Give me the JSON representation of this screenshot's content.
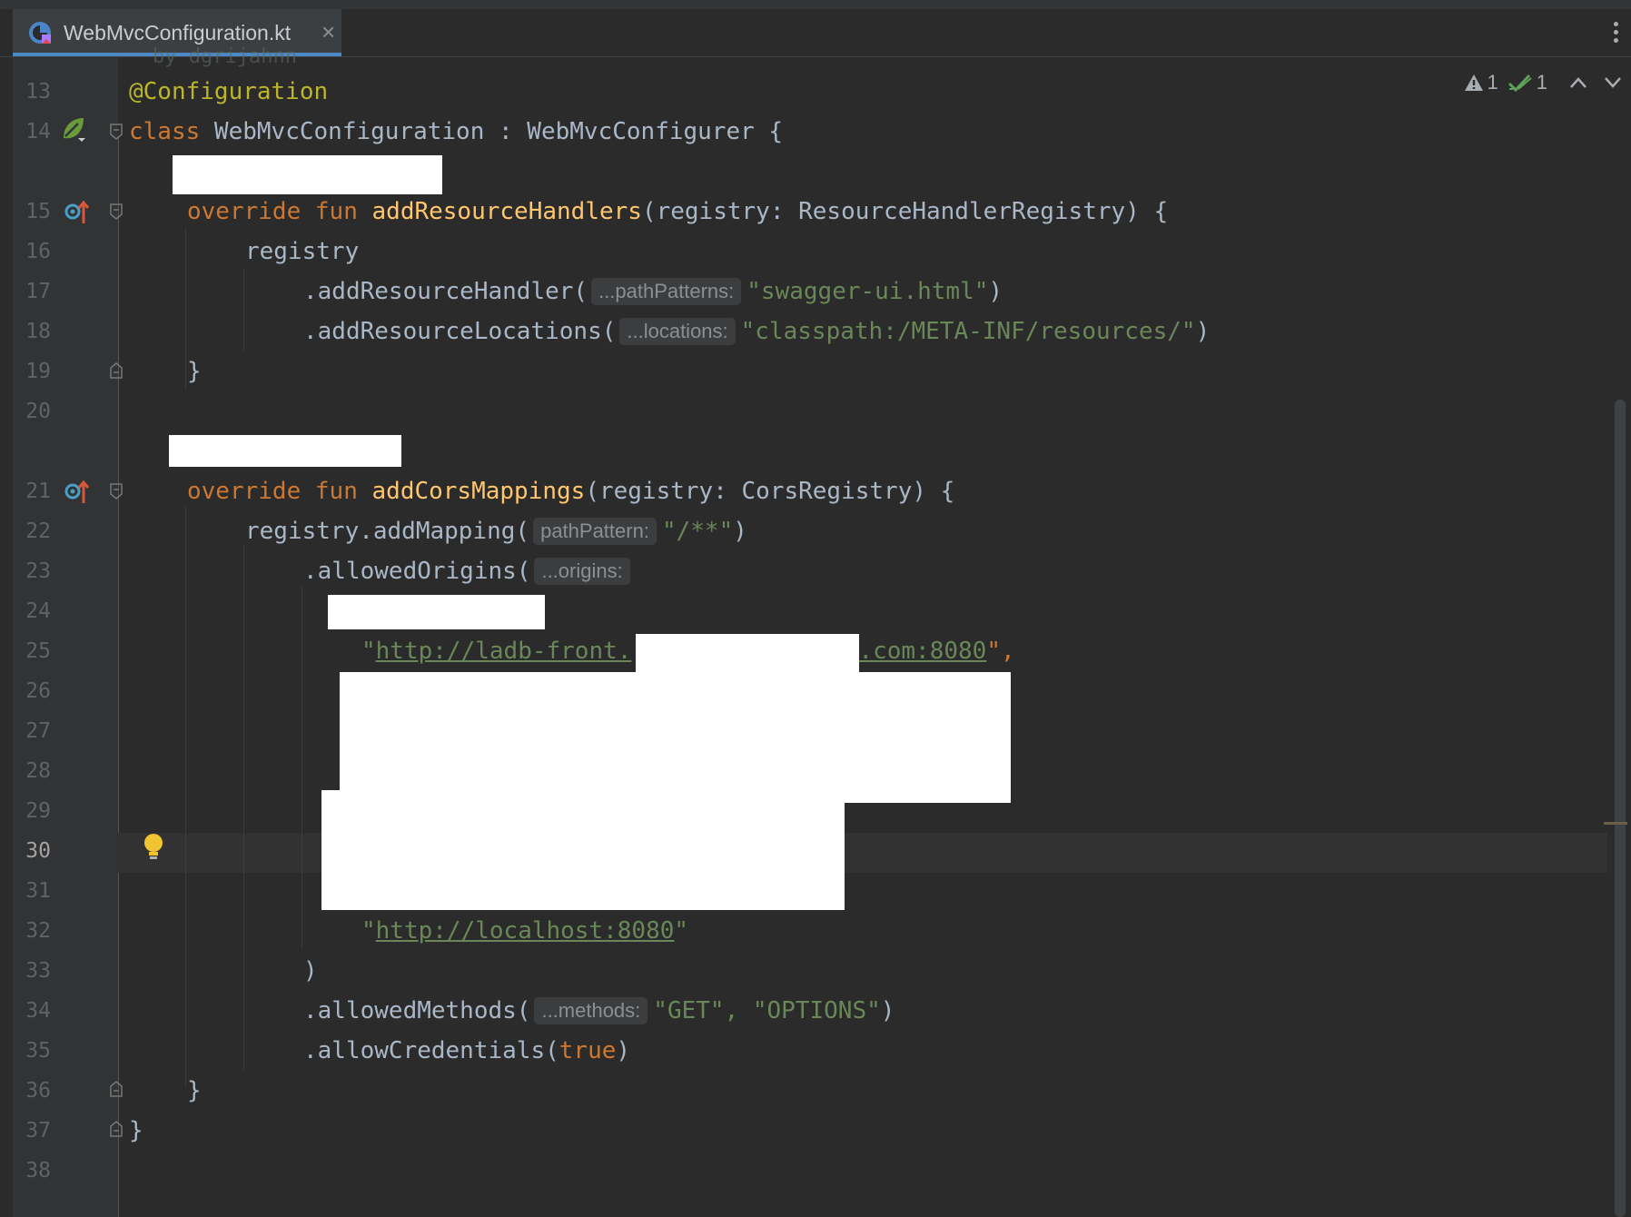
{
  "tab": {
    "filename": "WebMvcConfiguration.kt"
  },
  "indicators": {
    "warnings": "1",
    "checks": "1"
  },
  "partial_line_text": "by dgrijahnn",
  "editor": {
    "line_numbers": [
      "13",
      "14",
      "15",
      "16",
      "17",
      "18",
      "19",
      "20",
      "21",
      "22",
      "23",
      "24",
      "25",
      "26",
      "27",
      "28",
      "29",
      "30",
      "31",
      "32",
      "33",
      "34",
      "35",
      "36",
      "37",
      "38"
    ],
    "current_line": "30",
    "code": {
      "l13_annotation": "@Configuration",
      "l14_class_kw": "class",
      "l14_rest": " WebMvcConfiguration : WebMvcConfigurer {",
      "override_kw": "override",
      "fun_kw": "fun",
      "l15_name": "addResourceHandlers",
      "l15_rest": "(registry: ResourceHandlerRegistry) {",
      "l16": "registry",
      "l17_call": ".addResourceHandler(",
      "l17_hint": "...pathPatterns:",
      "l17_str": "\"swagger-ui.html\"",
      "close_paren": ")",
      "l18_call": ".addResourceLocations(",
      "l18_hint": "...locations:",
      "l18_str": "\"classpath:/META-INF/resources/\"",
      "close_brace": "}",
      "l21_name": "addCorsMappings",
      "l21_rest": "(registry: CorsRegistry) {",
      "l22_call": "registry.addMapping(",
      "l22_hint": "pathPattern:",
      "l22_str": "\"/**\"",
      "l23_call": ".allowedOrigins(",
      "l23_hint": "...origins:",
      "quote": "\"",
      "l25_url_start": "http://ladb-front.",
      "l25_url_end": ".com:8080",
      "l25_tail": "\",",
      "l32_url": "http://localhost:8080",
      "l34_call": ".allowedMethods(",
      "l34_hint": "...methods:",
      "l34_args": "\"GET\", \"OPTIONS\"",
      "l35_call": ".allowCredentials(",
      "l35_true": "true"
    }
  }
}
